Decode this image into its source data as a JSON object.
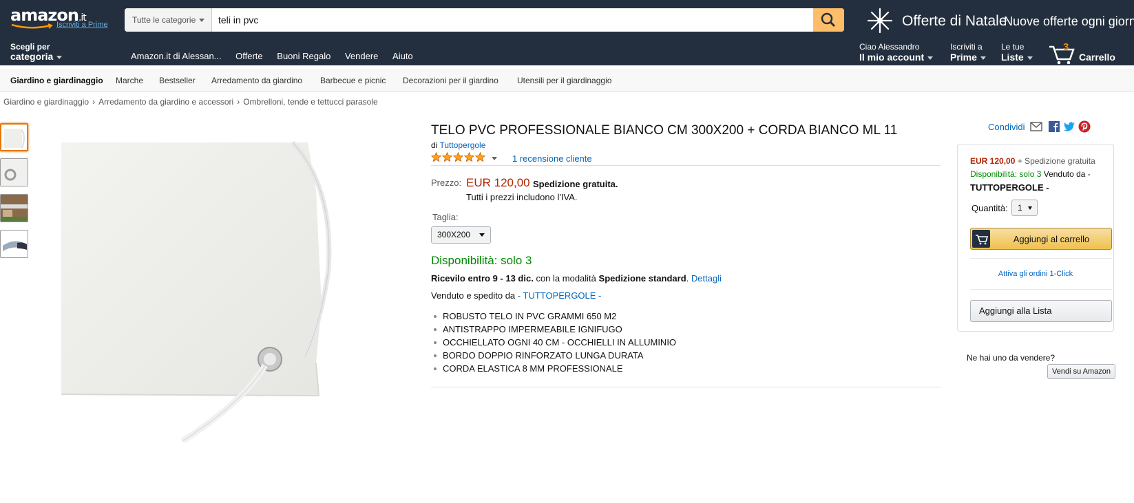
{
  "header": {
    "logo_text": "amazon",
    "logo_tld": ".it",
    "logo_sub": "Iscriviti a Prime",
    "search_category": "Tutte le categorie",
    "search_query": "teli in pvc",
    "promo_title": "Offerte di Natale",
    "promo_sub": "Nuove offerte ogni giorno",
    "deliver_line1": "Scegli per",
    "deliver_line2": "categoria",
    "nav_links": [
      "Amazon.it di Alessan...",
      "Offerte",
      "Buoni Regalo",
      "Vendere",
      "Aiuto"
    ],
    "account_line1": "Ciao Alessandro",
    "account_line2": "Il mio account",
    "prime_line1": "Iscriviti a",
    "prime_line2": "Prime",
    "lists_line1": "Le tue",
    "lists_line2": "Liste",
    "cart_count": "3",
    "cart_label": "Carrello"
  },
  "subnav": [
    "Giardino e giardinaggio",
    "Marche",
    "Bestseller",
    "Arredamento da giardino",
    "Barbecue e picnic",
    "Decorazioni per il giardino",
    "Utensili per il giardinaggio"
  ],
  "breadcrumb": [
    "Giardino e giardinaggio",
    "Arredamento da giardino e accessori",
    "Ombrelloni, tende e tettucci parasole"
  ],
  "product": {
    "title": "TELO PVC PROFESSIONALE BIANCO CM 300X200 + CORDA BIANCO ML 11",
    "by_prefix": "di",
    "brand": "Tuttopergole",
    "rating_stars": 5,
    "reviews": "1 recensione cliente",
    "price_label": "Prezzo:",
    "price": "EUR 120,00",
    "shipping": "Spedizione gratuita.",
    "vat_note": "Tutti i prezzi includono l'IVA.",
    "size_label": "Taglia:",
    "size_value": "300X200",
    "availability": "Disponibilità: solo 3",
    "delivery_bold": "Ricevilo entro 9 - 13 dic.",
    "delivery_mid": "con la modalità",
    "delivery_method": "Spedizione standard",
    "delivery_link": "Dettagli",
    "seller_prefix": "Venduto e spedito da",
    "seller": "- TUTTOPERGOLE -",
    "bullets": [
      "ROBUSTO TELO IN PVC GRAMMI 650 M2",
      "ANTISTRAPPO IMPERMEABILE IGNIFUGO",
      "OCCHIELLATO OGNI 40 CM - OCCHIELLI IN ALLUMINIO",
      "BORDO DOPPIO RINFORZATO LUNGA DURATA",
      "CORDA ELASTICA 8 MM PROFESSIONALE"
    ]
  },
  "buybox": {
    "share": "Condividi",
    "price": "EUR 120,00",
    "shipping": "+ Spedizione gratuita",
    "availability": "Disponibilità: solo 3",
    "sold_by": "Venduto da",
    "seller": "TUTTOPERGOLE -",
    "qty_label": "Quantità:",
    "qty_value": "1",
    "add_to_cart": "Aggiungi al carrello",
    "one_click": "Attiva gli ordini 1-Click",
    "add_to_list": "Aggiungi alla Lista",
    "sell_question": "Ne hai uno da vendere?",
    "sell_button": "Vendi su Amazon"
  },
  "colors": {
    "nav": "#232f3e",
    "price": "#b12704",
    "availability": "#008a00",
    "link": "#0066c0",
    "search_button": "#febd69"
  }
}
